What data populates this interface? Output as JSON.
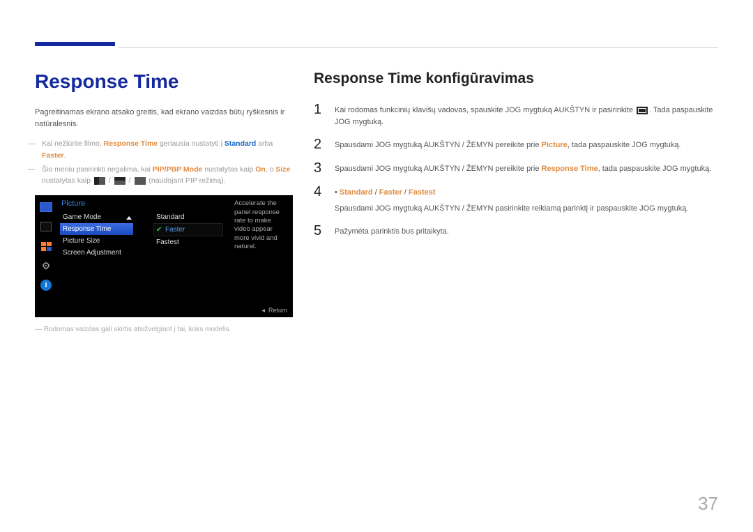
{
  "header": {},
  "left": {
    "title": "Response Time",
    "desc": "Pagreitinamas ekrano atsako greitis, kad ekrano vaizdas būtų ryškesnis ir natūralesnis.",
    "note1_pre": "Kai nežiūrite filmo, ",
    "note1_rt": "Response Time",
    "note1_mid": " geriausia nustatyti į ",
    "note1_std": "Standard",
    "note1_arba": " arba ",
    "note1_faster": "Faster",
    "note1_end": ".",
    "note2_pre": "Šio meniu pasirinkti negalima, kai ",
    "note2_pip": "PIP/PBP Mode",
    "note2_mid": " nustatytas kaip ",
    "note2_on": "On",
    "note2_o": ", o ",
    "note2_size": "Size",
    "note2_line2_pre": "nustatytas kaip ",
    "note2_line2_end": " (naudojant PIP režimą).",
    "footnote": "Rodomas vaizdas gali skirtis atsižvelgiant į tai, koks modelis."
  },
  "osd": {
    "menu_title": "Picture",
    "items": [
      "Game Mode",
      "Response Time",
      "Picture Size",
      "Screen Adjustment"
    ],
    "options": [
      "Standard",
      "Faster",
      "Fastest"
    ],
    "info": "Accelerate the panel response rate to make video appear more vivid and natural.",
    "return": "Return"
  },
  "right": {
    "title": "Response Time konfigūravimas",
    "step1_pre": "Kai rodomas funkcinių klavišų vadovas, spauskite JOG mygtuką AUKŠTYN ir pasirinkite ",
    "step1_end": ". Tada paspauskite JOG mygtuką.",
    "step2_pre": "Spausdami JOG mygtuką AUKŠTYN / ŽEMYN pereikite prie ",
    "step2_picture": "Picture",
    "step2_end": ", tada paspauskite JOG mygtuką.",
    "step3_pre": "Spausdami JOG mygtuką AUKŠTYN / ŽEMYN pereikite prie ",
    "step3_rt": "Response Time",
    "step3_end": ", tada paspauskite JOG mygtuką.",
    "step4_sub_std": "Standard",
    "step4_sub_slash1": " / ",
    "step4_sub_faster": "Faster",
    "step4_sub_slash2": " / ",
    "step4_sub_fastest": "Fastest",
    "step4": "Spausdami JOG mygtuką AUKŠTYN / ŽEMYN pasirinkite reikiamą parinktį ir paspauskite JOG mygtuką.",
    "step5": "Pažymėta parinktis bus pritaikyta."
  },
  "page_num": "37"
}
